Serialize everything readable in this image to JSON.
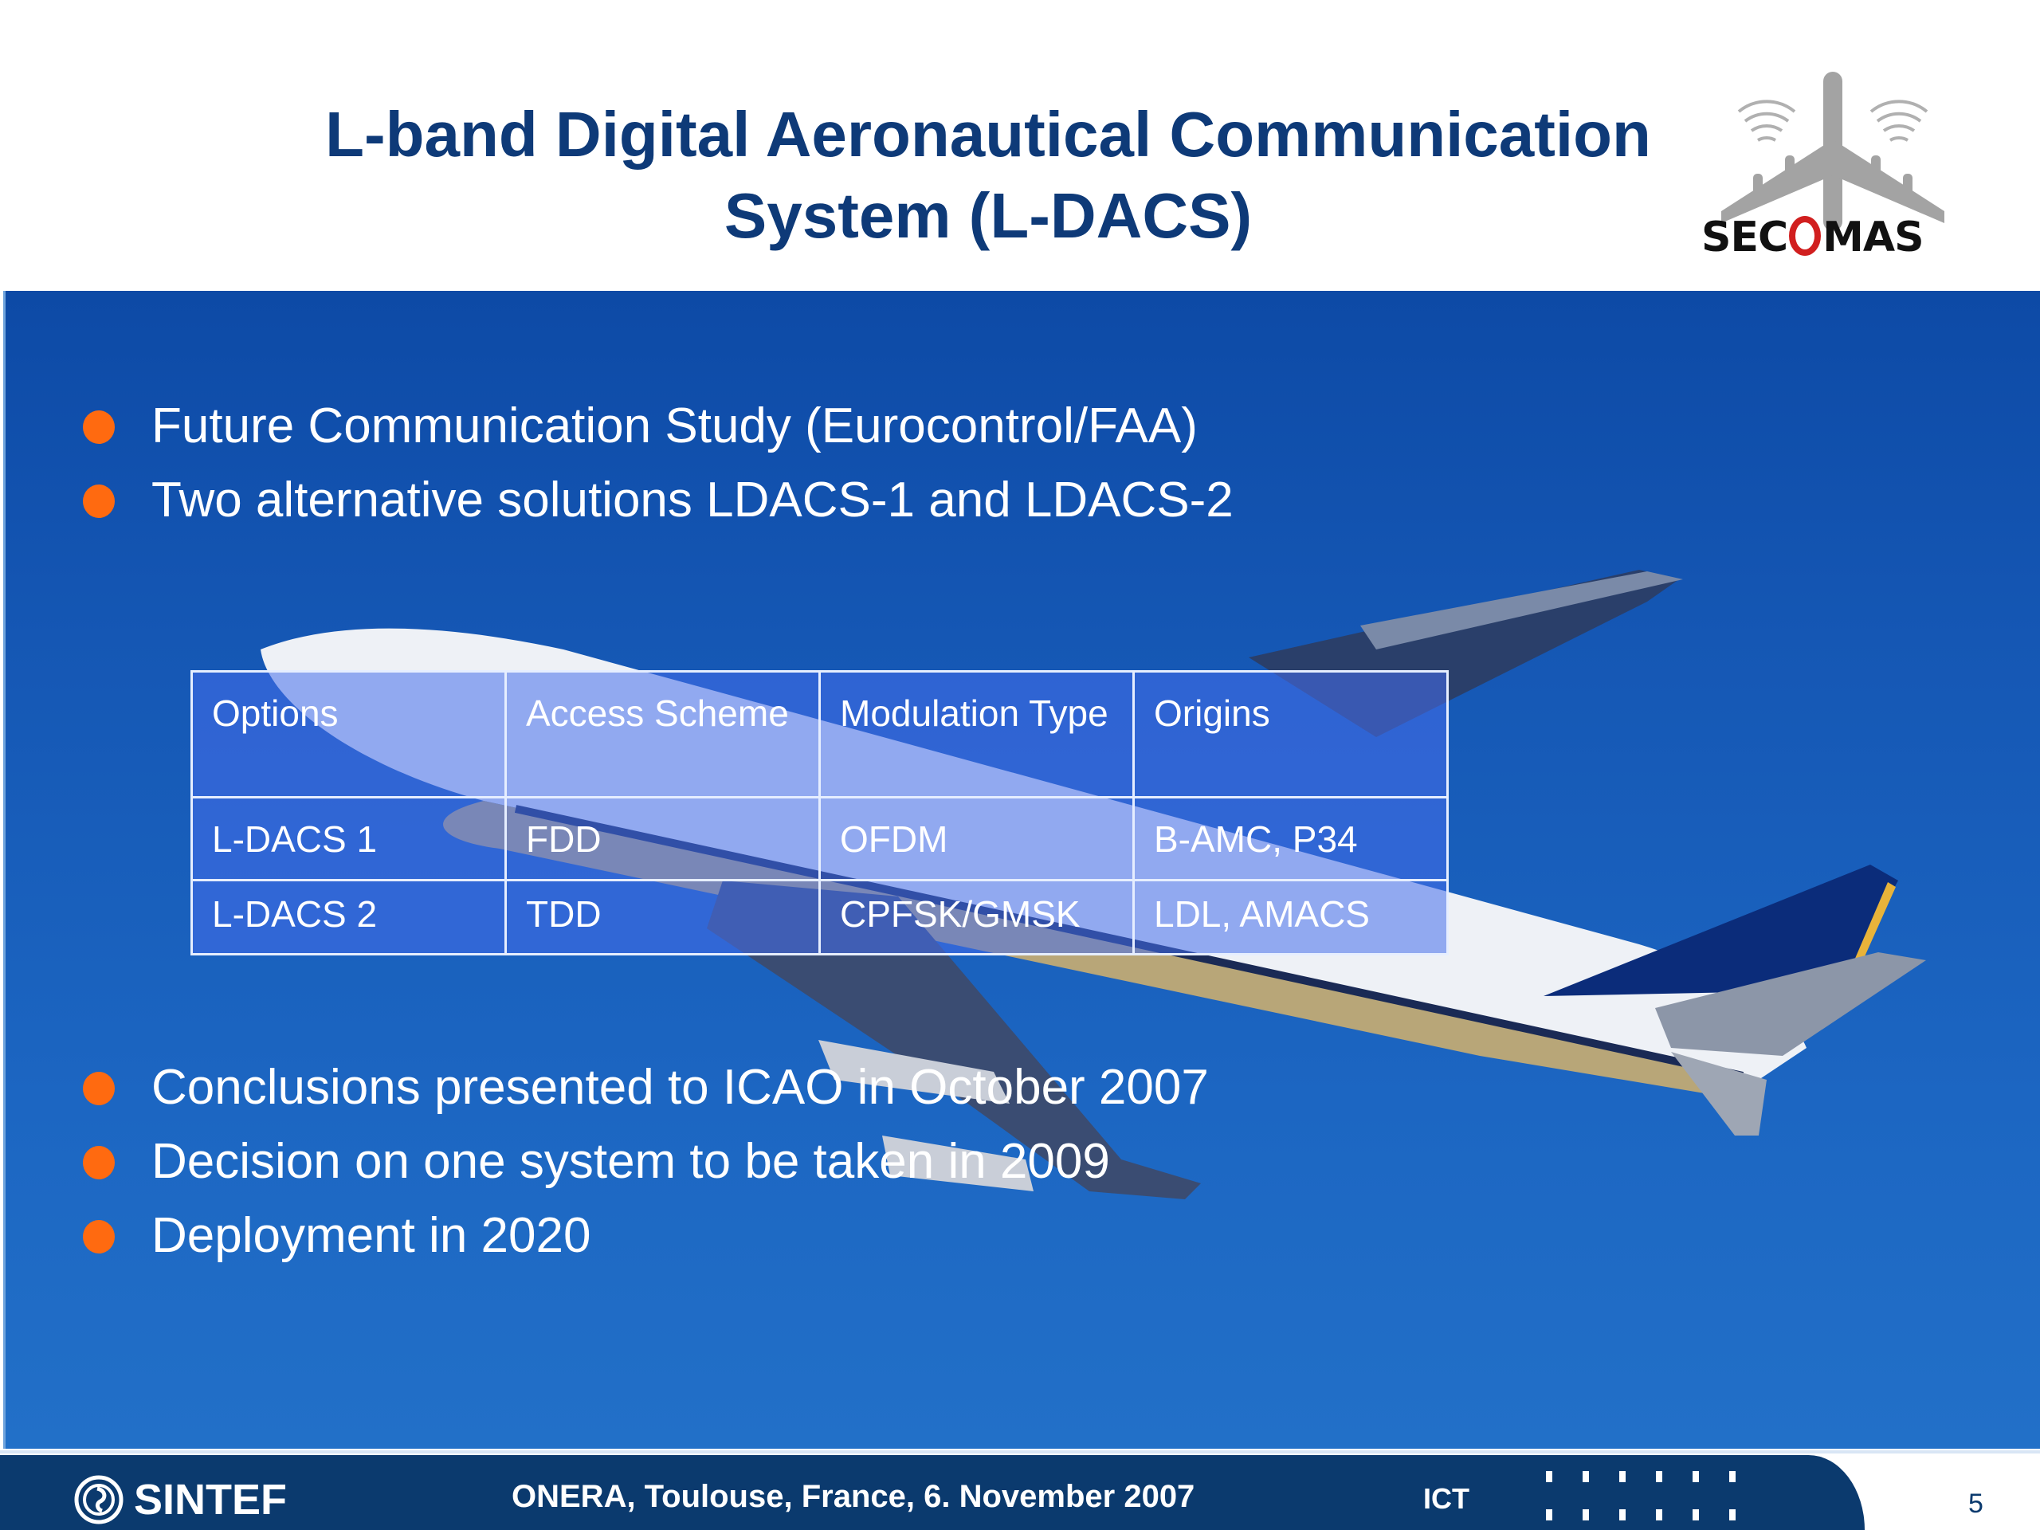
{
  "slide": {
    "title_line1": "L-band Digital Aeronautical Communication",
    "title_line2": "System (L-DACS)",
    "logo": {
      "name": "SECOMAS",
      "text_left": "SEC",
      "text_right": "MAS",
      "accent": "#d11f1f"
    },
    "bullets_top": [
      "Future Communication Study (Eurocontrol/FAA)",
      "Two alternative solutions LDACS-1 and LDACS-2"
    ],
    "table": {
      "headers": [
        "Options",
        "Access Scheme",
        "Modulation Type",
        "Origins"
      ],
      "rows": [
        [
          "L-DACS 1",
          "FDD",
          "OFDM",
          "B-AMC, P34"
        ],
        [
          "L-DACS 2",
          "TDD",
          "CPFSK/GMSK",
          "LDL, AMACS"
        ]
      ]
    },
    "bullets_bottom": [
      "Conclusions presented to ICAO in October 2007",
      "Decision on one system to be taken in 2009",
      "Deployment in 2020"
    ],
    "bullet_icon": "orange-dot",
    "colors": {
      "title": "#0e3a78",
      "bullet": "#ff6a10",
      "footer": "#0b3a6e",
      "panel": "#1c66c2"
    }
  },
  "footer": {
    "org": "SINTEF",
    "event": "ONERA, Toulouse, France, 6. November 2007",
    "unit": "ICT",
    "page": "5"
  }
}
